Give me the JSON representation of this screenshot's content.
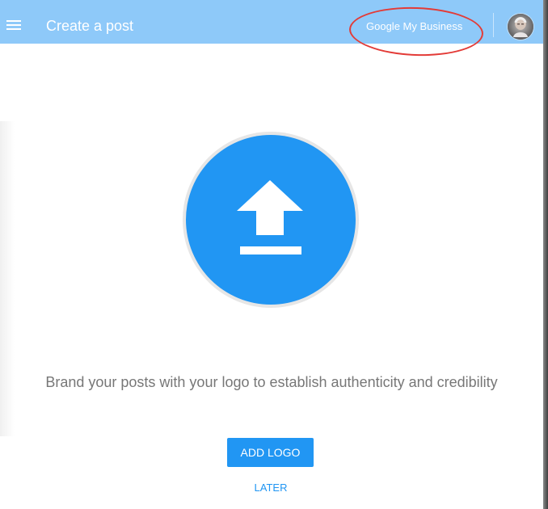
{
  "header": {
    "title": "Create a post",
    "brand_link": "Google My Business",
    "menu_icon": "hamburger-menu-icon",
    "avatar_icon": "user-avatar-icon"
  },
  "main": {
    "upload_icon": "upload-icon",
    "message": "Brand your posts with your logo to establish authenticity and credibility",
    "add_logo_label": "ADD LOGO",
    "later_label": "LATER"
  },
  "colors": {
    "app_bar": "#8ec9f9",
    "primary": "#2196f3",
    "text_muted": "#777777",
    "annotation": "#e33b37"
  }
}
